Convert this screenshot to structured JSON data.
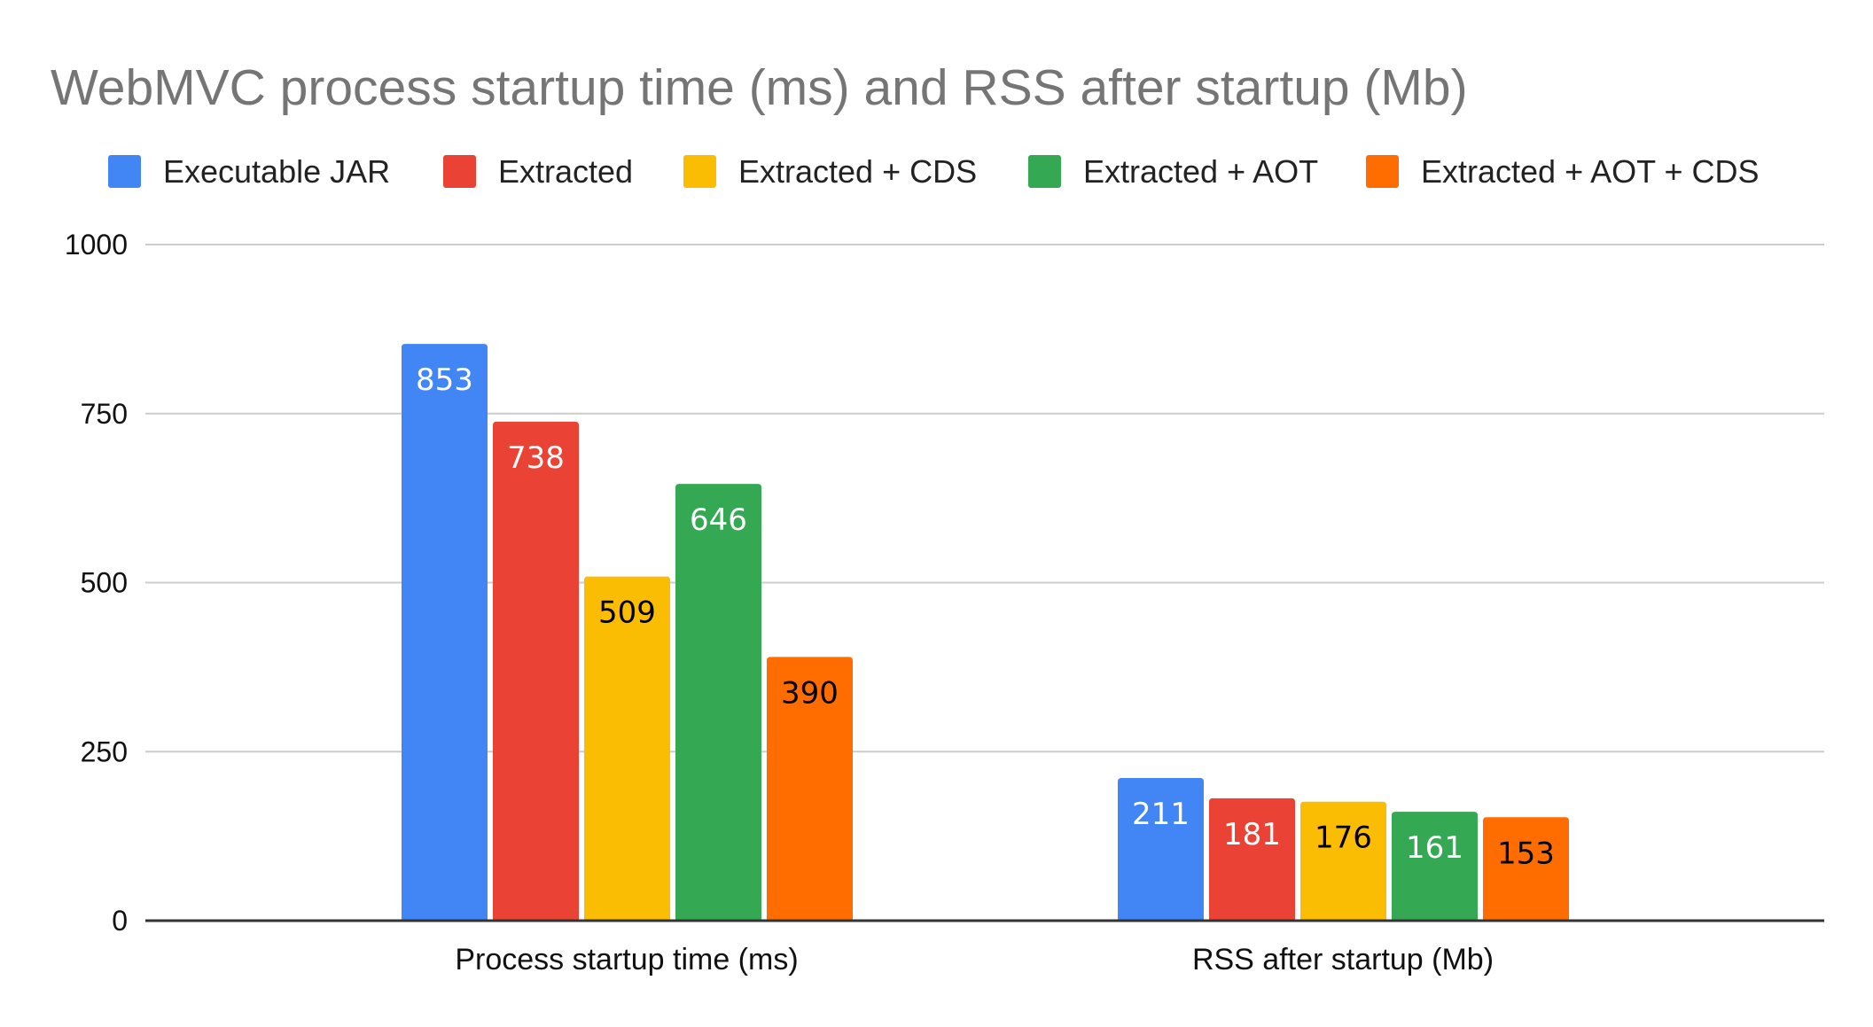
{
  "chart_data": {
    "type": "bar",
    "title": "WebMVC process startup time (ms) and RSS after startup (Mb)",
    "xlabel": "",
    "ylabel": "",
    "categories": [
      "Process startup time (ms)",
      "RSS after startup (Mb)"
    ],
    "series": [
      {
        "name": "Executable JAR",
        "color": "#4285F4",
        "label_color": "#ffffff",
        "values": [
          853,
          211
        ]
      },
      {
        "name": "Extracted",
        "color": "#EA4335",
        "label_color": "#ffffff",
        "values": [
          738,
          181
        ]
      },
      {
        "name": "Extracted + CDS",
        "color": "#FBBC04",
        "label_color": "#000000",
        "values": [
          509,
          176
        ]
      },
      {
        "name": "Extracted + AOT",
        "color": "#34A853",
        "label_color": "#ffffff",
        "values": [
          646,
          161
        ]
      },
      {
        "name": "Extracted + AOT + CDS",
        "color": "#FF6D01",
        "label_color": "#000000",
        "values": [
          390,
          153
        ]
      }
    ],
    "ylim": [
      0,
      1000
    ],
    "yticks": [
      0,
      250,
      500,
      750,
      1000
    ],
    "grid": true,
    "legend_position": "top",
    "data_labels": true
  }
}
